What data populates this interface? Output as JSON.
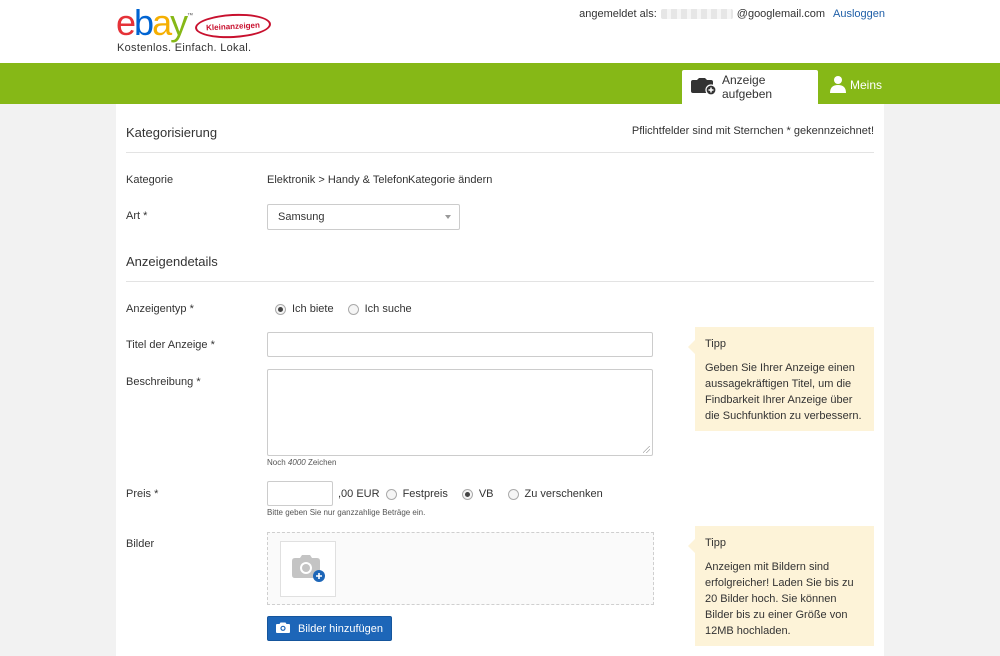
{
  "header": {
    "logo": {
      "word": [
        "e",
        "b",
        "a",
        "y"
      ],
      "tm": "™",
      "badge": "Kleinanzeigen"
    },
    "tagline": "Kostenlos. Einfach. Lokal.",
    "logged_in_label": "angemeldet als:",
    "email_masked": "xxxxxxxx",
    "email_domain": "@googlemail.com",
    "logout": "Ausloggen"
  },
  "nav": {
    "post_ad": "Anzeige aufgeben",
    "meins": "Meins",
    "bar_color": "#86b817"
  },
  "form": {
    "section_categorization": "Kategorisierung",
    "required_note": "Pflichtfelder sind mit Sternchen * gekennzeichnet!",
    "category_label": "Kategorie",
    "category_value": "Elektronik > Handy & Telefon",
    "category_change": "Kategorie ändern",
    "type_label": "Art *",
    "type_value": "Samsung",
    "section_details": "Anzeigendetails",
    "ad_type_label": "Anzeigentyp *",
    "ad_type_options": [
      "Ich biete",
      "Ich suche"
    ],
    "ad_type_selected": "Ich biete",
    "title_label": "Titel der Anzeige *",
    "title_value": "",
    "description_label": "Beschreibung *",
    "description_value": "",
    "chars_left_prefix": "Noch",
    "chars_left": "4000",
    "chars_left_suffix": "Zeichen",
    "price_label": "Preis *",
    "price_value": "",
    "price_suffix": ",00 EUR",
    "price_options": [
      "Festpreis",
      "VB",
      "Zu verschenken"
    ],
    "price_selected": "VB",
    "price_hint": "Bitte geben Sie nur ganzzahlige Beträge ein.",
    "images_label": "Bilder",
    "add_images_button": "Bilder hinzufügen"
  },
  "tips": [
    {
      "title": "Tipp",
      "text": "Geben Sie Ihrer Anzeige einen aussagekräftigen Titel, um die Findbarkeit Ihrer Anzeige über die Suchfunktion zu verbessern."
    },
    {
      "title": "Tipp",
      "text": "Anzeigen mit Bildern sind erfolgreicher! Laden Sie bis zu 20 Bilder hoch. Sie können Bilder bis zu einer Größe von 12MB hochladen."
    }
  ],
  "icons": {
    "post_ad": "camera-plus-icon",
    "meins": "user-icon",
    "photo_slot": "camera-add-icon",
    "button": "camera-icon"
  },
  "colors": {
    "link": "#1f5fa8",
    "button": "#1d66b8",
    "tip_bg": "#fdf3d8"
  }
}
